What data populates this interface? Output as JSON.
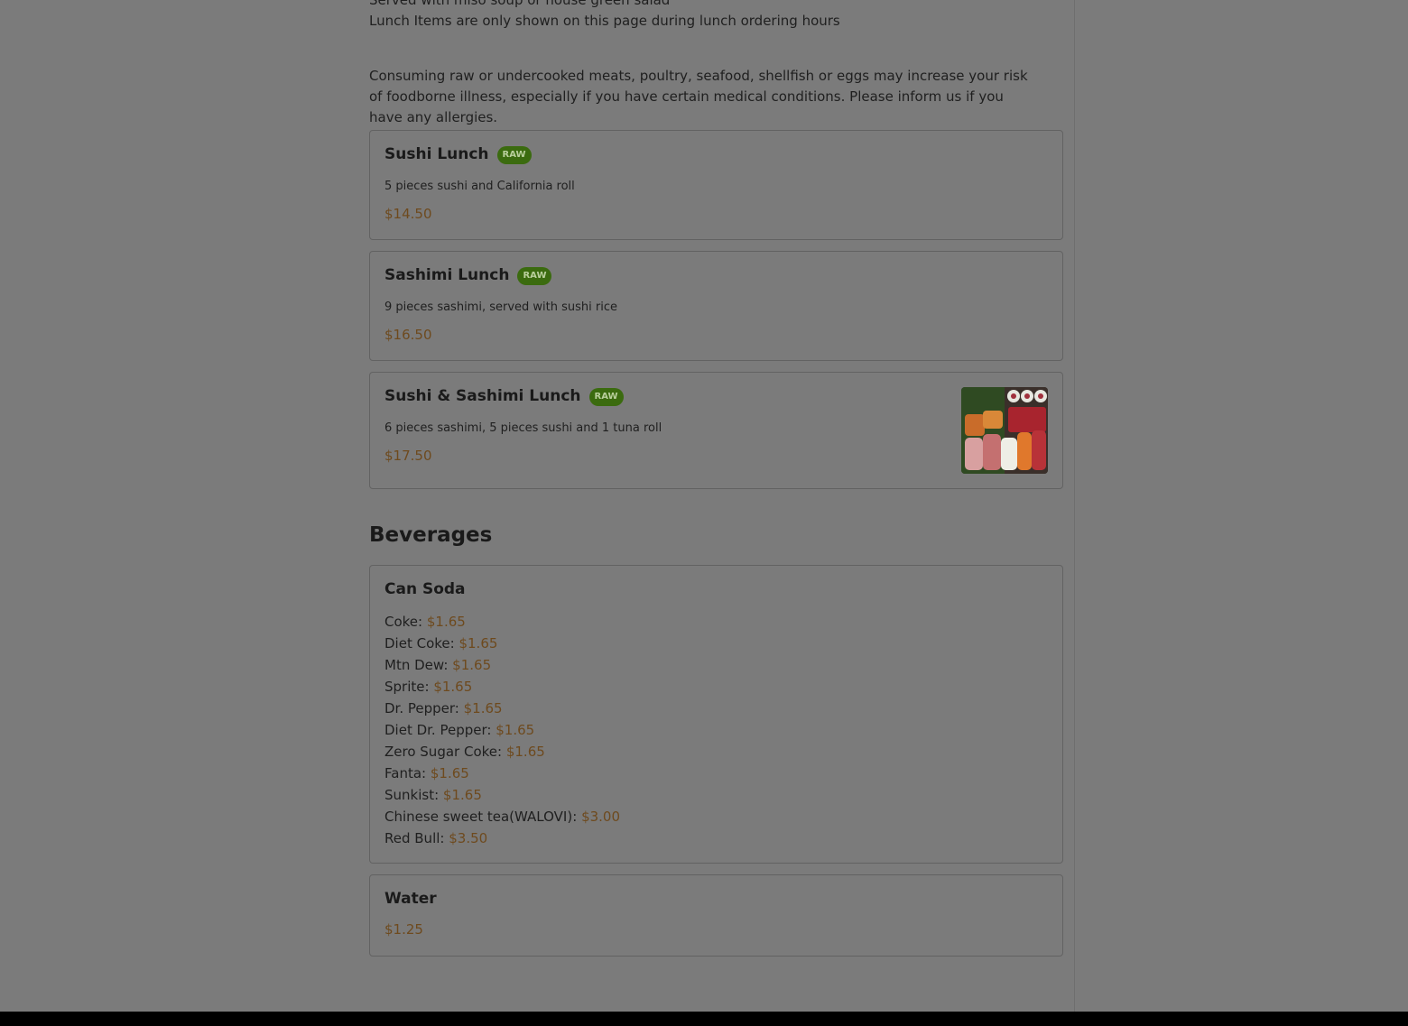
{
  "intro": {
    "served_with": "Served with miso soup or house green salad",
    "hours_note": "Lunch Items are only shown on this page during lunch ordering hours",
    "warning": "Consuming raw or undercooked meats, poultry, seafood, shellfish or eggs may increase your risk of foodborne illness, especially if you have certain medical conditions. Please inform us if you have any allergies."
  },
  "lunch_items": [
    {
      "name": "Sushi Lunch",
      "badge": "RAW",
      "description": "5 pieces sushi and California roll",
      "price": "$14.50"
    },
    {
      "name": "Sashimi Lunch",
      "badge": "RAW",
      "description": "9 pieces sashimi, served with sushi rice",
      "price": "$16.50"
    },
    {
      "name": "Sushi & Sashimi Lunch",
      "badge": "RAW",
      "description": "6 pieces sashimi, 5 pieces sushi and 1 tuna roll",
      "price": "$17.50",
      "image_icon": "sushi-platter-photo"
    }
  ],
  "beverages": {
    "section_title": "Beverages",
    "can_soda": {
      "name": "Can Soda",
      "options": [
        {
          "label": "Coke:",
          "price": "$1.65"
        },
        {
          "label": "Diet Coke:",
          "price": "$1.65"
        },
        {
          "label": "Mtn Dew:",
          "price": "$1.65"
        },
        {
          "label": "Sprite:",
          "price": "$1.65"
        },
        {
          "label": "Dr. Pepper:",
          "price": "$1.65"
        },
        {
          "label": "Diet Dr. Pepper:",
          "price": "$1.65"
        },
        {
          "label": "Zero Sugar Coke:",
          "price": "$1.65"
        },
        {
          "label": "Fanta:",
          "price": "$1.65"
        },
        {
          "label": "Sunkist:",
          "price": "$1.65"
        },
        {
          "label": "Chinese sweet tea(WALOVI):",
          "price": "$3.00"
        },
        {
          "label": "Red Bull:",
          "price": "$3.50"
        }
      ]
    },
    "water": {
      "name": "Water",
      "price": "$1.25"
    }
  },
  "colors": {
    "overlay_background": "#7b7b7b",
    "price": "#6e4a1e",
    "raw_badge": "#3b6b0f"
  }
}
